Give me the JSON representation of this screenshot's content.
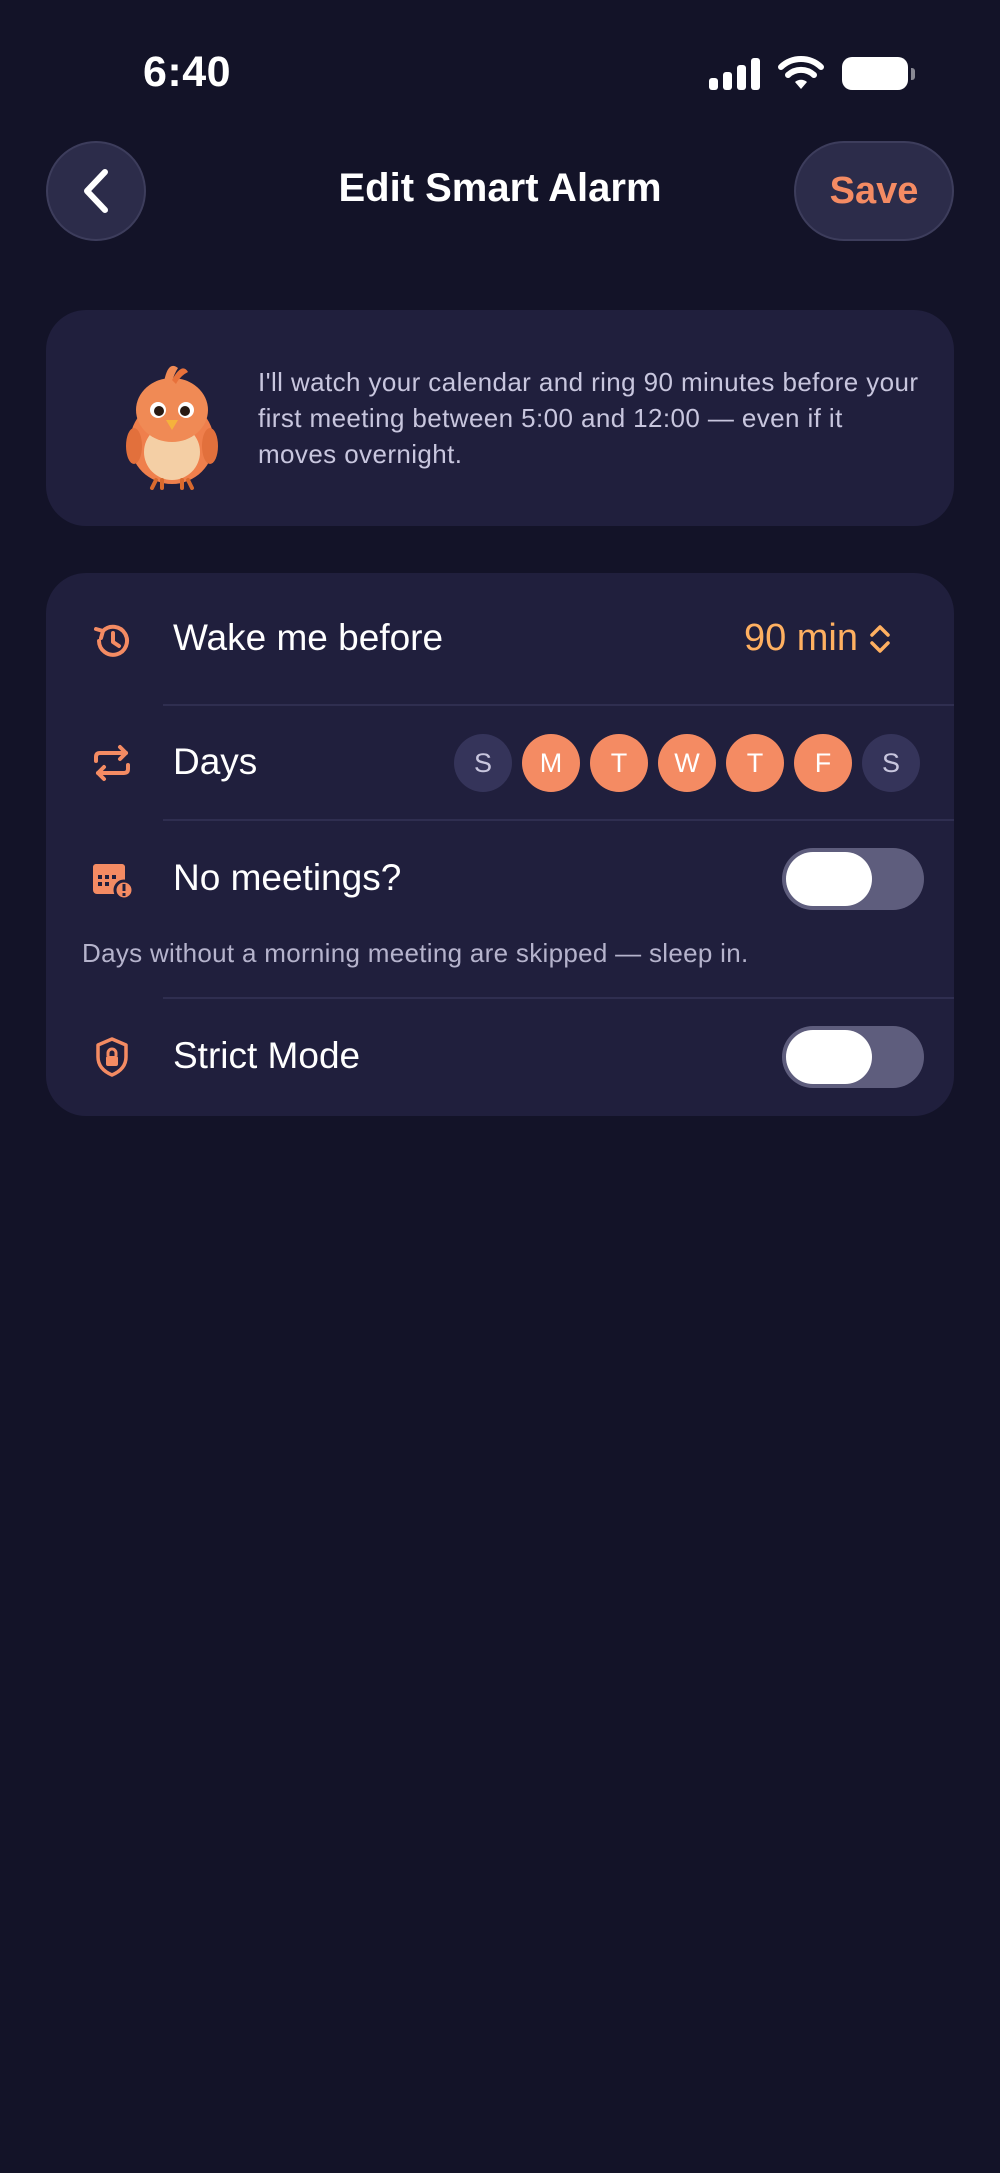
{
  "status_bar": {
    "time": "6:40"
  },
  "header": {
    "title": "Edit Smart Alarm",
    "save_label": "Save"
  },
  "info": {
    "text": "I'll watch your calendar and ring 90 minutes before your first meeting between 5:00 and 12:00 — even if it moves overnight."
  },
  "settings": {
    "wake": {
      "label": "Wake me before",
      "value": "90 min"
    },
    "days": {
      "label": "Days",
      "items": [
        {
          "letter": "S",
          "selected": false
        },
        {
          "letter": "M",
          "selected": true
        },
        {
          "letter": "T",
          "selected": true
        },
        {
          "letter": "W",
          "selected": true
        },
        {
          "letter": "T",
          "selected": true
        },
        {
          "letter": "F",
          "selected": true
        },
        {
          "letter": "S",
          "selected": false
        }
      ]
    },
    "no_meetings": {
      "label": "No meetings?",
      "helper": "Days without a morning meeting are skipped — sleep in.",
      "enabled": false
    },
    "strict_mode": {
      "label": "Strict Mode",
      "enabled": false
    }
  },
  "colors": {
    "accent": "#f48b63",
    "value": "#ffb061",
    "background": "#131328",
    "card": "#201f3d"
  }
}
